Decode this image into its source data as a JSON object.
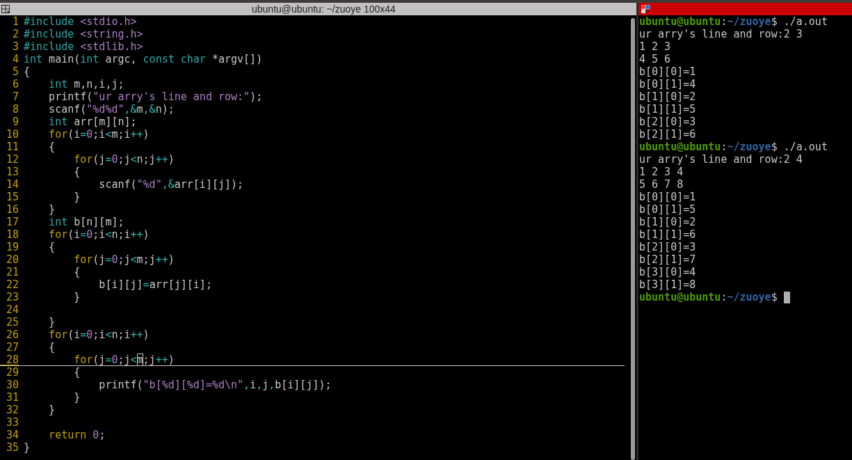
{
  "editor": {
    "title": "ubuntu@ubuntu: ~/zuoye 100x44",
    "lines": [
      {
        "number": "1",
        "current": false,
        "tokens": [
          {
            "kind": "pre",
            "text": "#include"
          },
          {
            "kind": "inc",
            "text": " <stdio.h>"
          }
        ]
      },
      {
        "number": "2",
        "current": false,
        "tokens": [
          {
            "kind": "pre",
            "text": "#include"
          },
          {
            "kind": "inc",
            "text": " <string.h>"
          }
        ]
      },
      {
        "number": "3",
        "current": false,
        "tokens": [
          {
            "kind": "pre",
            "text": "#include"
          },
          {
            "kind": "inc",
            "text": " <stdlib.h>"
          }
        ]
      },
      {
        "number": "4",
        "current": false,
        "tokens": [
          {
            "kind": "type",
            "text": "int"
          },
          {
            "kind": "plain",
            "text": " main("
          },
          {
            "kind": "type",
            "text": "int"
          },
          {
            "kind": "plain",
            "text": " argc, "
          },
          {
            "kind": "type",
            "text": "const char"
          },
          {
            "kind": "plain",
            "text": " *argv[])"
          }
        ]
      },
      {
        "number": "5",
        "current": false,
        "tokens": [
          {
            "kind": "plain",
            "text": "{"
          }
        ]
      },
      {
        "number": "6",
        "current": false,
        "tokens": [
          {
            "kind": "type",
            "text": "    int"
          },
          {
            "kind": "plain",
            "text": " m,n,i,j;"
          }
        ]
      },
      {
        "number": "7",
        "current": false,
        "tokens": [
          {
            "kind": "plain",
            "text": "    printf("
          },
          {
            "kind": "str",
            "text": "\"ur arry's line and row:\""
          },
          {
            "kind": "plain",
            "text": ");"
          }
        ]
      },
      {
        "number": "8",
        "current": false,
        "tokens": [
          {
            "kind": "plain",
            "text": "    scanf("
          },
          {
            "kind": "str",
            "text": "\"%d%d\""
          },
          {
            "kind": "op",
            "text": ",&"
          },
          {
            "kind": "plain",
            "text": "m"
          },
          {
            "kind": "op",
            "text": ",&"
          },
          {
            "kind": "plain",
            "text": "n);"
          }
        ]
      },
      {
        "number": "9",
        "current": false,
        "tokens": [
          {
            "kind": "type",
            "text": "    int"
          },
          {
            "kind": "plain",
            "text": " arr[m][n];"
          }
        ]
      },
      {
        "number": "10",
        "current": false,
        "tokens": [
          {
            "kind": "kw",
            "text": "    for"
          },
          {
            "kind": "plain",
            "text": "(i"
          },
          {
            "kind": "op",
            "text": "="
          },
          {
            "kind": "num",
            "text": "0"
          },
          {
            "kind": "plain",
            "text": ";i"
          },
          {
            "kind": "op",
            "text": "<"
          },
          {
            "kind": "plain",
            "text": "m;i"
          },
          {
            "kind": "op",
            "text": "++"
          },
          {
            "kind": "plain",
            "text": ")"
          }
        ]
      },
      {
        "number": "11",
        "current": false,
        "tokens": [
          {
            "kind": "plain",
            "text": "    {"
          }
        ]
      },
      {
        "number": "12",
        "current": false,
        "tokens": [
          {
            "kind": "kw",
            "text": "        for"
          },
          {
            "kind": "plain",
            "text": "(j"
          },
          {
            "kind": "op",
            "text": "="
          },
          {
            "kind": "num",
            "text": "0"
          },
          {
            "kind": "plain",
            "text": ";j"
          },
          {
            "kind": "op",
            "text": "<"
          },
          {
            "kind": "plain",
            "text": "n;j"
          },
          {
            "kind": "op",
            "text": "++"
          },
          {
            "kind": "plain",
            "text": ")"
          }
        ]
      },
      {
        "number": "13",
        "current": false,
        "tokens": [
          {
            "kind": "plain",
            "text": "        {"
          }
        ]
      },
      {
        "number": "14",
        "current": false,
        "tokens": [
          {
            "kind": "plain",
            "text": "            scanf("
          },
          {
            "kind": "str",
            "text": "\"%d\""
          },
          {
            "kind": "op",
            "text": ",&"
          },
          {
            "kind": "plain",
            "text": "arr[i][j]);"
          }
        ]
      },
      {
        "number": "15",
        "current": false,
        "tokens": [
          {
            "kind": "plain",
            "text": "        }"
          }
        ]
      },
      {
        "number": "16",
        "current": false,
        "tokens": [
          {
            "kind": "plain",
            "text": "    }"
          }
        ]
      },
      {
        "number": "17",
        "current": false,
        "tokens": [
          {
            "kind": "type",
            "text": "    int"
          },
          {
            "kind": "plain",
            "text": " b[n][m];"
          }
        ]
      },
      {
        "number": "18",
        "current": false,
        "tokens": [
          {
            "kind": "kw",
            "text": "    for"
          },
          {
            "kind": "plain",
            "text": "(i"
          },
          {
            "kind": "op",
            "text": "="
          },
          {
            "kind": "num",
            "text": "0"
          },
          {
            "kind": "plain",
            "text": ";i"
          },
          {
            "kind": "op",
            "text": "<"
          },
          {
            "kind": "plain",
            "text": "n;i"
          },
          {
            "kind": "op",
            "text": "++"
          },
          {
            "kind": "plain",
            "text": ")"
          }
        ]
      },
      {
        "number": "19",
        "current": false,
        "tokens": [
          {
            "kind": "plain",
            "text": "    {"
          }
        ]
      },
      {
        "number": "20",
        "current": false,
        "tokens": [
          {
            "kind": "kw",
            "text": "        for"
          },
          {
            "kind": "plain",
            "text": "(j"
          },
          {
            "kind": "op",
            "text": "="
          },
          {
            "kind": "num",
            "text": "0"
          },
          {
            "kind": "plain",
            "text": ";j"
          },
          {
            "kind": "op",
            "text": "<"
          },
          {
            "kind": "plain",
            "text": "m;j"
          },
          {
            "kind": "op",
            "text": "++"
          },
          {
            "kind": "plain",
            "text": ")"
          }
        ]
      },
      {
        "number": "21",
        "current": false,
        "tokens": [
          {
            "kind": "plain",
            "text": "        {"
          }
        ]
      },
      {
        "number": "22",
        "current": false,
        "tokens": [
          {
            "kind": "plain",
            "text": "            b[i][j]"
          },
          {
            "kind": "op",
            "text": "="
          },
          {
            "kind": "plain",
            "text": "arr[j][i];"
          }
        ]
      },
      {
        "number": "23",
        "current": false,
        "tokens": [
          {
            "kind": "plain",
            "text": "        }"
          }
        ]
      },
      {
        "number": "24",
        "current": false
      },
      {
        "number": "25",
        "current": false,
        "tokens": [
          {
            "kind": "plain",
            "text": "    }"
          }
        ]
      },
      {
        "number": "26",
        "current": false,
        "tokens": [
          {
            "kind": "kw",
            "text": "    for"
          },
          {
            "kind": "plain",
            "text": "(i"
          },
          {
            "kind": "op",
            "text": "="
          },
          {
            "kind": "num",
            "text": "0"
          },
          {
            "kind": "plain",
            "text": ";i"
          },
          {
            "kind": "op",
            "text": "<"
          },
          {
            "kind": "plain",
            "text": "n;i"
          },
          {
            "kind": "op",
            "text": "++"
          },
          {
            "kind": "plain",
            "text": ")"
          }
        ]
      },
      {
        "number": "27",
        "current": false,
        "tokens": [
          {
            "kind": "plain",
            "text": "    {"
          }
        ]
      },
      {
        "number": "28",
        "current": true,
        "tokens": [
          {
            "kind": "kw",
            "text": "        for"
          },
          {
            "kind": "plain",
            "text": "(j"
          },
          {
            "kind": "op",
            "text": "="
          },
          {
            "kind": "num",
            "text": "0"
          },
          {
            "kind": "plain",
            "text": ";j"
          },
          {
            "kind": "op",
            "text": "<"
          },
          {
            "kind": "cursor",
            "text": "m"
          },
          {
            "kind": "plain",
            "text": ";j"
          },
          {
            "kind": "op",
            "text": "++"
          },
          {
            "kind": "plain",
            "text": ")"
          }
        ]
      },
      {
        "number": "29",
        "current": false,
        "tokens": [
          {
            "kind": "plain",
            "text": "        {"
          }
        ]
      },
      {
        "number": "30",
        "current": false,
        "tokens": [
          {
            "kind": "plain",
            "text": "            printf("
          },
          {
            "kind": "str",
            "text": "\"b[%d][%d]=%d\\n\""
          },
          {
            "kind": "op",
            "text": ","
          },
          {
            "kind": "plain",
            "text": "i"
          },
          {
            "kind": "op",
            "text": ","
          },
          {
            "kind": "plain",
            "text": "j"
          },
          {
            "kind": "op",
            "text": ","
          },
          {
            "kind": "plain",
            "text": "b[i][j]);"
          }
        ]
      },
      {
        "number": "31",
        "current": false,
        "tokens": [
          {
            "kind": "plain",
            "text": "        }"
          }
        ]
      },
      {
        "number": "32",
        "current": false,
        "tokens": [
          {
            "kind": "plain",
            "text": "    }"
          }
        ]
      },
      {
        "number": "33",
        "current": false
      },
      {
        "number": "34",
        "current": false,
        "tokens": [
          {
            "kind": "kw",
            "text": "    return"
          },
          {
            "kind": "num",
            "text": " 0"
          },
          {
            "kind": "plain",
            "text": ";"
          }
        ]
      },
      {
        "number": "35",
        "current": false,
        "tokens": [
          {
            "kind": "plain",
            "text": "}"
          }
        ]
      }
    ]
  },
  "terminal": {
    "lines": [
      {
        "kind": "prompt",
        "user_host": "ubuntu@ubuntu",
        "sep": ":",
        "path": "~/zuoye",
        "symbol": "$",
        "command": " ./a.out",
        "cursor": false
      },
      {
        "kind": "output",
        "text": "ur arry's line and row:2 3"
      },
      {
        "kind": "output",
        "text": "1 2 3"
      },
      {
        "kind": "output",
        "text": "4 5 6"
      },
      {
        "kind": "output",
        "text": "b[0][0]=1"
      },
      {
        "kind": "output",
        "text": "b[0][1]=4"
      },
      {
        "kind": "output",
        "text": "b[1][0]=2"
      },
      {
        "kind": "output",
        "text": "b[1][1]=5"
      },
      {
        "kind": "output",
        "text": "b[2][0]=3"
      },
      {
        "kind": "output",
        "text": "b[2][1]=6"
      },
      {
        "kind": "prompt",
        "user_host": "ubuntu@ubuntu",
        "sep": ":",
        "path": "~/zuoye",
        "symbol": "$",
        "command": " ./a.out",
        "cursor": false
      },
      {
        "kind": "output",
        "text": "ur arry's line and row:2 4"
      },
      {
        "kind": "output",
        "text": "1 2 3 4"
      },
      {
        "kind": "output",
        "text": "5 6 7 8"
      },
      {
        "kind": "output",
        "text": "b[0][0]=1"
      },
      {
        "kind": "output",
        "text": "b[0][1]=5"
      },
      {
        "kind": "output",
        "text": "b[1][0]=2"
      },
      {
        "kind": "output",
        "text": "b[1][1]=6"
      },
      {
        "kind": "output",
        "text": "b[2][0]=3"
      },
      {
        "kind": "output",
        "text": "b[2][1]=7"
      },
      {
        "kind": "output",
        "text": "b[3][0]=4"
      },
      {
        "kind": "output",
        "text": "b[3][1]=8"
      },
      {
        "kind": "prompt",
        "user_host": "ubuntu@ubuntu",
        "sep": ":",
        "path": "~/zuoye",
        "symbol": "$",
        "cursor": true
      }
    ]
  }
}
